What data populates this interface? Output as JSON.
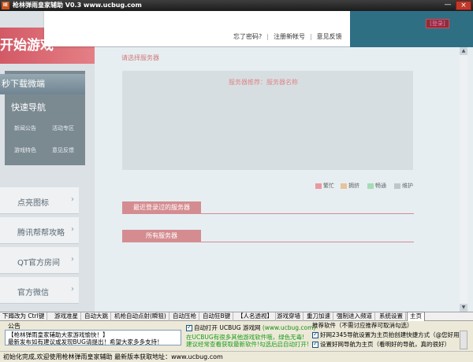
{
  "window": {
    "title": "枪林弹雨皇家辅助 V0.3  www.ucbug.com",
    "icon": "app-logo-icon",
    "minimize_glyph": "—",
    "close_glyph": "×"
  },
  "header": {
    "links": [
      "忘了密码?",
      "注册新帐号",
      "意见反馈"
    ],
    "separator": "|",
    "promo_text": "开始游戏",
    "badge": "[登录]"
  },
  "sidebar": {
    "download": "秒下载微端",
    "fast_nav": "快速导航",
    "grid": [
      "新闻公告",
      "活动专区",
      "游戏特色",
      "意见反馈"
    ],
    "items": [
      {
        "label": "点亮图标",
        "icon": "chevron-right-icon"
      },
      {
        "label": "腾讯帮帮攻略",
        "icon": "chevron-right-icon"
      },
      {
        "label": "QT官方房间",
        "icon": "chevron-right-icon"
      },
      {
        "label": "官方微信",
        "icon": "chevron-right-icon"
      }
    ]
  },
  "server": {
    "select_label": "请选择服务器",
    "recommend": "服务器推荐：服务器名称",
    "legend": [
      {
        "label": "繁忙",
        "color": "#e89aa0"
      },
      {
        "label": "拥挤",
        "color": "#e8c39a"
      },
      {
        "label": "畅通",
        "color": "#a6dcb4"
      },
      {
        "label": "维护",
        "color": "#bfc6cb"
      }
    ],
    "recent_label": "最近登录过的服务器",
    "all_label": "所有服务器"
  },
  "tabs": [
    "下蹲改为 Ctrl键",
    "游戏准星",
    "自动大跳",
    "机枪自动点射(瞬狙)",
    "自动压枪",
    "自动狂B键",
    "【人名透视】",
    "游戏穿墙",
    "重刀加速",
    "强制进入频道",
    "系统设置",
    "主页"
  ],
  "active_tab": "主页",
  "notice": {
    "title": "公告",
    "lines": [
      "【枪林弹雨皇家辅助大家游戏愉快！】",
      "最新发布如有建议或发现BUG请提出！希望大家多多支持！"
    ]
  },
  "auto_open": {
    "label": "自动打开 UCBUG 游戏网",
    "site": "(www.ucbug.com)",
    "checked": true
  },
  "green_note": "在UCBUG有很多其他游戏软件哦，绿色无毒!建议经常查看获取最新软件!勾选后启自动打开!",
  "recommend": {
    "title": "推荐软件（不需讨应推荐可取消勾选）",
    "options": [
      {
        "label": "好网2345导航设置为主页拍创建快捷方式（@您好用）",
        "checked": true
      },
      {
        "label": "设置好网导航为主页（看明好的导航，真的很好）",
        "checked": true
      }
    ]
  },
  "status_bar": "初始化完成,欢迎使用枪林弹雨皇家辅助 最新版本获取地址：www.ucbug.com"
}
